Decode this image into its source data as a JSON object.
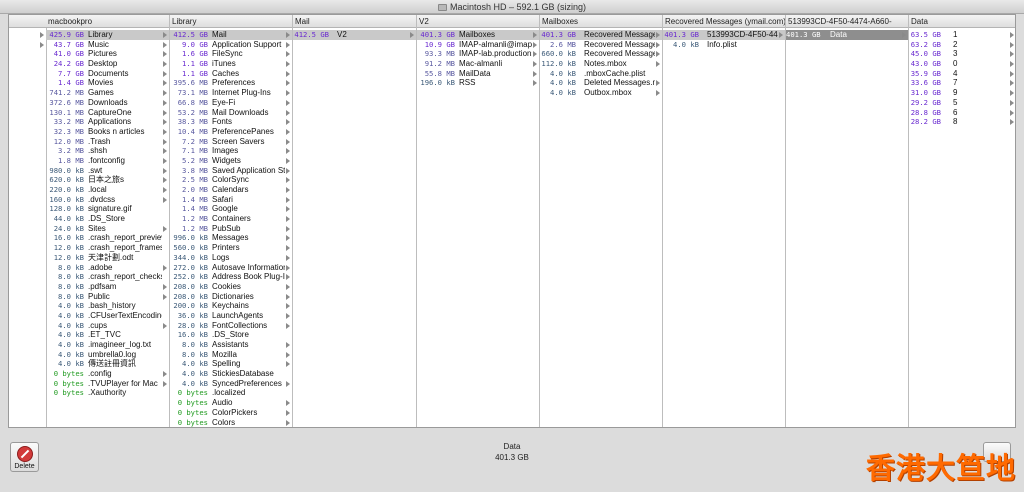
{
  "window": {
    "title": "Macintosh HD – 592.1 GB (sizing)"
  },
  "columns": [
    {
      "header": "macbookpro",
      "rows": [
        {
          "size": "425.9 GB",
          "name": "Library",
          "unit": "gb",
          "sel": true,
          "arrow": true
        },
        {
          "size": "43.7 GB",
          "name": "Music",
          "unit": "gb",
          "arrow": true
        },
        {
          "size": "41.0 GB",
          "name": "Pictures",
          "unit": "gb",
          "arrow": true
        },
        {
          "size": "24.2 GB",
          "name": "Desktop",
          "unit": "gb",
          "arrow": true
        },
        {
          "size": "7.7 GB",
          "name": "Documents",
          "unit": "gb",
          "arrow": true
        },
        {
          "size": "1.4 GB",
          "name": "Movies",
          "unit": "gb",
          "arrow": true
        },
        {
          "size": "741.2 MB",
          "name": "Games",
          "unit": "mb",
          "arrow": true
        },
        {
          "size": "372.6 MB",
          "name": "Downloads",
          "unit": "mb",
          "arrow": true
        },
        {
          "size": "130.1 MB",
          "name": "CaptureOne",
          "unit": "mb",
          "arrow": true
        },
        {
          "size": "33.2 MB",
          "name": "Applications",
          "unit": "mb",
          "arrow": true
        },
        {
          "size": "32.3 MB",
          "name": "Books n articles",
          "unit": "mb",
          "arrow": true
        },
        {
          "size": "12.0 MB",
          "name": ".Trash",
          "unit": "mb",
          "arrow": true
        },
        {
          "size": "3.2 MB",
          "name": ".shsh",
          "unit": "mb",
          "arrow": true
        },
        {
          "size": "1.8 MB",
          "name": ".fontconfig",
          "unit": "mb",
          "arrow": true
        },
        {
          "size": "980.0 kB",
          "name": ".swt",
          "unit": "kb",
          "arrow": true
        },
        {
          "size": "620.0 kB",
          "name": "日本之旅s",
          "unit": "kb",
          "arrow": true
        },
        {
          "size": "220.0 kB",
          "name": ".local",
          "unit": "kb",
          "arrow": true
        },
        {
          "size": "160.0 kB",
          "name": ".dvdcss",
          "unit": "kb",
          "arrow": true
        },
        {
          "size": "128.0 kB",
          "name": "signature.gif",
          "unit": "kb"
        },
        {
          "size": "44.0 kB",
          "name": ".DS_Store",
          "unit": "kb"
        },
        {
          "size": "24.0 kB",
          "name": "Sites",
          "unit": "kb",
          "arrow": true
        },
        {
          "size": "16.0 kB",
          "name": ".crash_report_preview",
          "unit": "kb"
        },
        {
          "size": "12.0 kB",
          "name": ".crash_report_frames",
          "unit": "kb"
        },
        {
          "size": "12.0 kB",
          "name": "天津計劃.odt",
          "unit": "kb"
        },
        {
          "size": "8.0 kB",
          "name": ".adobe",
          "unit": "kb",
          "arrow": true
        },
        {
          "size": "8.0 kB",
          "name": ".crash_report_checksum",
          "unit": "kb"
        },
        {
          "size": "8.0 kB",
          "name": ".pdfsam",
          "unit": "kb",
          "arrow": true
        },
        {
          "size": "8.0 kB",
          "name": "Public",
          "unit": "kb",
          "arrow": true
        },
        {
          "size": "4.0 kB",
          "name": ".bash_history",
          "unit": "kb"
        },
        {
          "size": "4.0 kB",
          "name": ".CFUserTextEncoding",
          "unit": "kb"
        },
        {
          "size": "4.0 kB",
          "name": ".cups",
          "unit": "kb",
          "arrow": true
        },
        {
          "size": "4.0 kB",
          "name": ".ET_TVC",
          "unit": "kb"
        },
        {
          "size": "4.0 kB",
          "name": ".imagineer_log.txt",
          "unit": "kb"
        },
        {
          "size": "4.0 kB",
          "name": "umbrella0.log",
          "unit": "kb"
        },
        {
          "size": "4.0 kB",
          "name": "傳送註冊資訊",
          "unit": "kb"
        },
        {
          "size": "0 bytes",
          "name": ".config",
          "unit": "b",
          "arrow": true
        },
        {
          "size": "0 bytes",
          "name": ".TVUPlayer for Mac",
          "unit": "b",
          "arrow": true
        },
        {
          "size": "0 bytes",
          "name": ".Xauthority",
          "unit": "b"
        }
      ]
    },
    {
      "header": "Library",
      "rows": [
        {
          "size": "412.5 GB",
          "name": "Mail",
          "unit": "gb",
          "sel": true,
          "arrow": true
        },
        {
          "size": "9.0 GB",
          "name": "Application Support",
          "unit": "gb",
          "arrow": true
        },
        {
          "size": "1.6 GB",
          "name": "FileSync",
          "unit": "gb",
          "arrow": true
        },
        {
          "size": "1.1 GB",
          "name": "iTunes",
          "unit": "gb",
          "arrow": true
        },
        {
          "size": "1.1 GB",
          "name": "Caches",
          "unit": "gb",
          "arrow": true
        },
        {
          "size": "395.6 MB",
          "name": "Preferences",
          "unit": "mb",
          "arrow": true
        },
        {
          "size": "73.1 MB",
          "name": "Internet Plug-Ins",
          "unit": "mb",
          "arrow": true
        },
        {
          "size": "66.8 MB",
          "name": "Eye-Fi",
          "unit": "mb",
          "arrow": true
        },
        {
          "size": "53.2 MB",
          "name": "Mail Downloads",
          "unit": "mb",
          "arrow": true
        },
        {
          "size": "38.3 MB",
          "name": "Fonts",
          "unit": "mb",
          "arrow": true
        },
        {
          "size": "10.4 MB",
          "name": "PreferencePanes",
          "unit": "mb",
          "arrow": true
        },
        {
          "size": "7.2 MB",
          "name": "Screen Savers",
          "unit": "mb",
          "arrow": true
        },
        {
          "size": "7.1 MB",
          "name": "Images",
          "unit": "mb",
          "arrow": true
        },
        {
          "size": "5.2 MB",
          "name": "Widgets",
          "unit": "mb",
          "arrow": true
        },
        {
          "size": "3.8 MB",
          "name": "Saved Application State",
          "unit": "mb",
          "arrow": true
        },
        {
          "size": "2.5 MB",
          "name": "ColorSync",
          "unit": "mb",
          "arrow": true
        },
        {
          "size": "2.0 MB",
          "name": "Calendars",
          "unit": "mb",
          "arrow": true
        },
        {
          "size": "1.4 MB",
          "name": "Safari",
          "unit": "mb",
          "arrow": true
        },
        {
          "size": "1.4 MB",
          "name": "Google",
          "unit": "mb",
          "arrow": true
        },
        {
          "size": "1.2 MB",
          "name": "Containers",
          "unit": "mb",
          "arrow": true
        },
        {
          "size": "1.2 MB",
          "name": "PubSub",
          "unit": "mb",
          "arrow": true
        },
        {
          "size": "996.0 kB",
          "name": "Messages",
          "unit": "kb",
          "arrow": true
        },
        {
          "size": "560.0 kB",
          "name": "Printers",
          "unit": "kb",
          "arrow": true
        },
        {
          "size": "344.0 kB",
          "name": "Logs",
          "unit": "kb",
          "arrow": true
        },
        {
          "size": "272.0 kB",
          "name": "Autosave Information",
          "unit": "kb",
          "arrow": true
        },
        {
          "size": "252.0 kB",
          "name": "Address Book Plug-Ins",
          "unit": "kb",
          "arrow": true
        },
        {
          "size": "208.0 kB",
          "name": "Cookies",
          "unit": "kb",
          "arrow": true
        },
        {
          "size": "208.0 kB",
          "name": "Dictionaries",
          "unit": "kb",
          "arrow": true
        },
        {
          "size": "200.0 kB",
          "name": "Keychains",
          "unit": "kb",
          "arrow": true
        },
        {
          "size": "36.0 kB",
          "name": "LaunchAgents",
          "unit": "kb",
          "arrow": true
        },
        {
          "size": "28.0 kB",
          "name": "FontCollections",
          "unit": "kb",
          "arrow": true
        },
        {
          "size": "16.0 kB",
          "name": ".DS_Store",
          "unit": "kb"
        },
        {
          "size": "8.0 kB",
          "name": "Assistants",
          "unit": "kb",
          "arrow": true
        },
        {
          "size": "8.0 kB",
          "name": "Mozilla",
          "unit": "kb",
          "arrow": true
        },
        {
          "size": "4.0 kB",
          "name": "Spelling",
          "unit": "kb",
          "arrow": true
        },
        {
          "size": "4.0 kB",
          "name": "StickiesDatabase",
          "unit": "kb"
        },
        {
          "size": "4.0 kB",
          "name": "SyncedPreferences",
          "unit": "kb",
          "arrow": true
        },
        {
          "size": "0 bytes",
          "name": ".localized",
          "unit": "b"
        },
        {
          "size": "0 bytes",
          "name": "Audio",
          "unit": "b",
          "arrow": true
        },
        {
          "size": "0 bytes",
          "name": "ColorPickers",
          "unit": "b",
          "arrow": true
        },
        {
          "size": "0 bytes",
          "name": "Colors",
          "unit": "b",
          "arrow": true
        }
      ]
    },
    {
      "header": "Mail",
      "rows": [
        {
          "size": "412.5 GB",
          "name": "V2",
          "unit": "gb",
          "sel": true,
          "arrow": true
        }
      ]
    },
    {
      "header": "V2",
      "rows": [
        {
          "size": "401.3 GB",
          "name": "Mailboxes",
          "unit": "gb",
          "sel": true,
          "arrow": true
        },
        {
          "size": "10.9 GB",
          "name": "IMAP-almanli@imap.gmail.com",
          "unit": "gb",
          "arrow": true
        },
        {
          "size": "93.3 MB",
          "name": "IMAP-lab.productions",
          "unit": "mb",
          "arrow": true
        },
        {
          "size": "91.2 MB",
          "name": "Mac-almanli",
          "unit": "mb",
          "arrow": true
        },
        {
          "size": "55.8 MB",
          "name": "MailData",
          "unit": "mb",
          "arrow": true
        },
        {
          "size": "196.0 kB",
          "name": "RSS",
          "unit": "kb",
          "arrow": true
        }
      ]
    },
    {
      "header": "Mailboxes",
      "rows": [
        {
          "size": "401.3 GB",
          "name": "Recovered Messages",
          "unit": "gb",
          "sel": true,
          "arrow": true
        },
        {
          "size": "2.6 MB",
          "name": "Recovered Messages",
          "unit": "mb",
          "arrow": true
        },
        {
          "size": "660.0 kB",
          "name": "Recovered Messages",
          "unit": "kb",
          "arrow": true
        },
        {
          "size": "112.0 kB",
          "name": "Notes.mbox",
          "unit": "kb",
          "arrow": true
        },
        {
          "size": "4.0 kB",
          "name": ".mboxCache.plist",
          "unit": "kb"
        },
        {
          "size": "4.0 kB",
          "name": "Deleted Messages.mbox",
          "unit": "kb",
          "arrow": true
        },
        {
          "size": "4.0 kB",
          "name": "Outbox.mbox",
          "unit": "kb",
          "arrow": true
        }
      ]
    },
    {
      "header": "Recovered Messages (ymail.com)",
      "rows": [
        {
          "size": "401.3 GB",
          "name": "513993CD-4F50-4474-A660",
          "unit": "gb",
          "sel": true,
          "arrow": true
        },
        {
          "size": "4.0 kB",
          "name": "Info.plist",
          "unit": "kb"
        }
      ]
    },
    {
      "header": "513993CD-4F50-4474-A660-",
      "rows": [
        {
          "size": "401.3 GB",
          "name": "Data",
          "unit": "gb",
          "selDark": true,
          "arrow": true
        }
      ]
    },
    {
      "header": "Data",
      "rows": [
        {
          "size": "63.5 GB",
          "name": "1",
          "unit": "gb",
          "arrow": true
        },
        {
          "size": "63.2 GB",
          "name": "2",
          "unit": "gb",
          "arrow": true
        },
        {
          "size": "45.0 GB",
          "name": "3",
          "unit": "gb",
          "arrow": true
        },
        {
          "size": "43.0 GB",
          "name": "0",
          "unit": "gb",
          "arrow": true
        },
        {
          "size": "35.9 GB",
          "name": "4",
          "unit": "gb",
          "arrow": true
        },
        {
          "size": "33.6 GB",
          "name": "7",
          "unit": "gb",
          "arrow": true
        },
        {
          "size": "31.0 GB",
          "name": "9",
          "unit": "gb",
          "arrow": true
        },
        {
          "size": "29.2 GB",
          "name": "5",
          "unit": "gb",
          "arrow": true
        },
        {
          "size": "28.8 GB",
          "name": "6",
          "unit": "gb",
          "arrow": true
        },
        {
          "size": "28.2 GB",
          "name": "8",
          "unit": "gb",
          "arrow": true
        }
      ]
    }
  ],
  "footer": {
    "delete_label": "Delete",
    "status_name": "Data",
    "status_size": "401.3 GB"
  },
  "watermark": "香港大笪地",
  "colors": {
    "gb": "#6a2bd0",
    "mb": "#5a5aa0",
    "kb": "#3c5a78",
    "bytes": "#1f9a1f",
    "watermark": "#ff6a00"
  }
}
